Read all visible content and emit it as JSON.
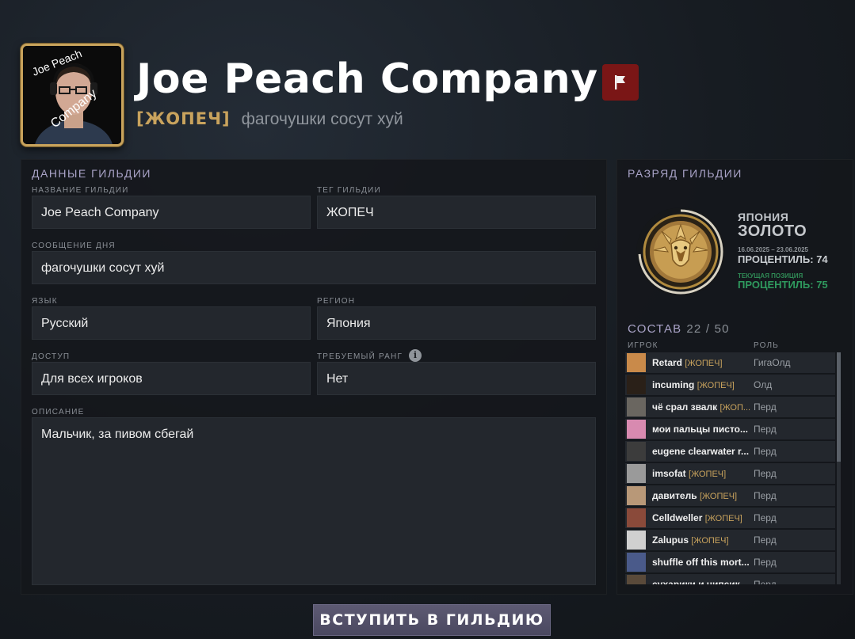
{
  "header": {
    "guild_name": "Joe Peach Company",
    "guild_tag": "[ЖОПЕЧ]",
    "motd": "фагочушки сосут хуй",
    "logo_text_1": "Joe Peach",
    "logo_text_2": "Company"
  },
  "details": {
    "section_title": "ДАННЫЕ ГИЛЬДИИ",
    "name_label": "НАЗВАНИЕ ГИЛЬДИИ",
    "name_value": "Joe Peach Company",
    "tag_label": "ТЕГ ГИЛЬДИИ",
    "tag_value": "ЖОПЕЧ",
    "motd_label": "СООБЩЕНИЕ ДНЯ",
    "motd_value": "фагочушки сосут хуй",
    "language_label": "ЯЗЫК",
    "language_value": "Русский",
    "region_label": "РЕГИОН",
    "region_value": "Япония",
    "access_label": "ДОСТУП",
    "access_value": "Для всех игроков",
    "rank_req_label": "ТРЕБУЕМЫЙ РАНГ",
    "rank_req_value": "Нет",
    "info_glyph": "i",
    "description_label": "ОПИСАНИЕ",
    "description_value": "Мальчик, за пивом сбегай"
  },
  "rank": {
    "section_title": "РАЗРЯД ГИЛЬДИИ",
    "region": "ЯПОНИЯ",
    "tier": "ЗОЛОТО",
    "dates": "16.06.2025 – 23.06.2025",
    "percentile": "ПРОЦЕНТИЛЬ: 74",
    "current_label": "ТЕКУЩАЯ ПОЗИЦИЯ",
    "current_percentile": "ПРОЦЕНТИЛЬ: 75",
    "medal_progress_fraction": 0.74
  },
  "roster": {
    "title": "СОСТАВ",
    "count": "22 / 50",
    "col_player": "ИГРОК",
    "col_role": "РОЛЬ",
    "members": [
      {
        "name": "Retard",
        "tag": "[ЖОПЕЧ]",
        "role": "ГигаОлд",
        "avatar_color": "#c98a4a"
      },
      {
        "name": "incuming",
        "tag": "[ЖОПЕЧ]",
        "role": "Олд",
        "avatar_color": "#2a2018"
      },
      {
        "name": "чё срал звалк",
        "tag": "[ЖОП...",
        "role": "Перд",
        "avatar_color": "#6a6660"
      },
      {
        "name": "мои пальцы писто...",
        "tag": "",
        "role": "Перд",
        "avatar_color": "#d88ab0"
      },
      {
        "name": "eugene clearwater r...",
        "tag": "",
        "role": "Перд",
        "avatar_color": "#3c3c3c"
      },
      {
        "name": "imsofat",
        "tag": "[ЖОПЕЧ]",
        "role": "Перд",
        "avatar_color": "#9a9a9a"
      },
      {
        "name": "давитель",
        "tag": "[ЖОПЕЧ]",
        "role": "Перд",
        "avatar_color": "#b89878"
      },
      {
        "name": "Celldweller",
        "tag": "[ЖОПЕЧ]",
        "role": "Перд",
        "avatar_color": "#8a4a3a"
      },
      {
        "name": "Zalupus",
        "tag": "[ЖОПЕЧ]",
        "role": "Перд",
        "avatar_color": "#d0d0d0"
      },
      {
        "name": "shuffle off this mort...",
        "tag": "",
        "role": "Перд",
        "avatar_color": "#4a5a8a"
      },
      {
        "name": "сухарики и чипсик...",
        "tag": "",
        "role": "Перд",
        "avatar_color": "#5a4a3a"
      }
    ]
  },
  "actions": {
    "join_label": "ВСТУПИТЬ В ГИЛЬДИЮ"
  },
  "colors": {
    "gold": "#c9a35d",
    "accent_label": "#a9a3c7",
    "report_red": "#7a1616",
    "current_green": "#2f9a5e"
  },
  "icons": {
    "report": "flag-icon",
    "info": "info-icon",
    "medal": "gold-rank-medal-icon"
  }
}
